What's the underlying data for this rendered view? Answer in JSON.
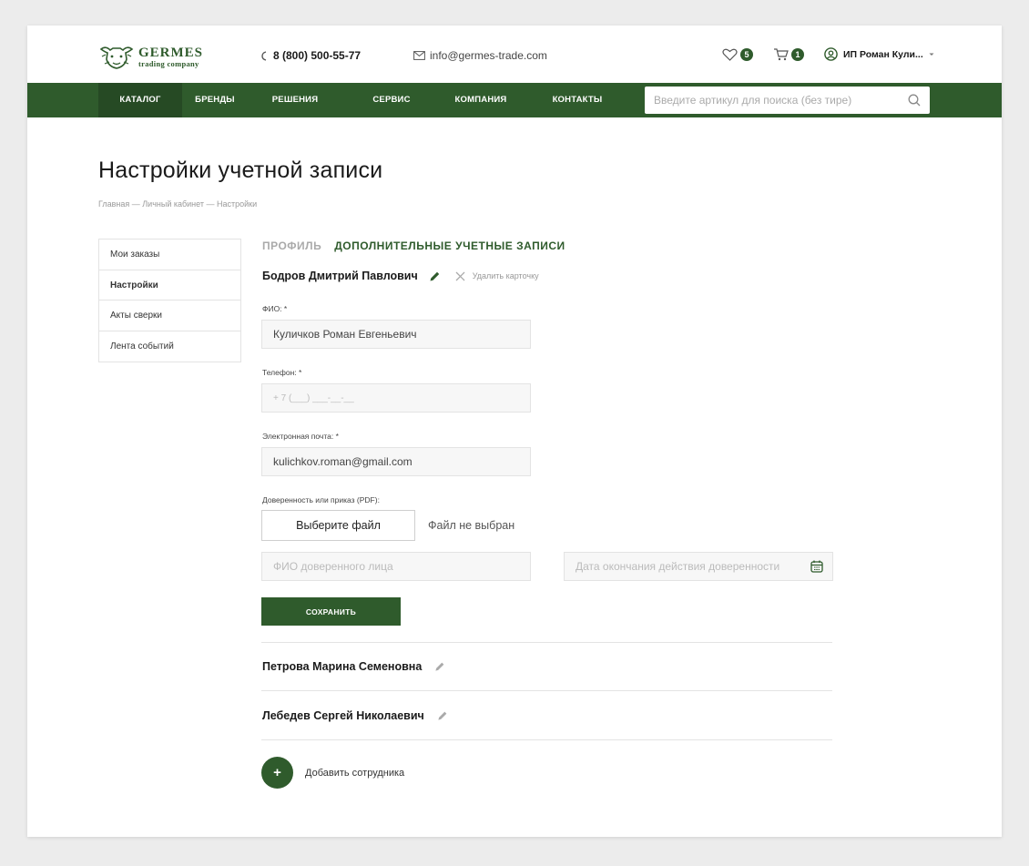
{
  "brand": {
    "title": "GERMES",
    "subtitle": "trading company"
  },
  "header": {
    "phone": "8 (800) 500-55-77",
    "email": "info@germes-trade.com",
    "favorites_count": "5",
    "cart_count": "1",
    "user_name": "ИП Роман Кули..."
  },
  "nav": {
    "items": [
      "КАТАЛОГ",
      "БРЕНДЫ",
      "РЕШЕНИЯ",
      "СЕРВИС",
      "КОМПАНИЯ",
      "КОНТАКТЫ"
    ],
    "search_placeholder": "Введите артикул для поиска (без тире)"
  },
  "page": {
    "title": "Настройки учетной записи",
    "breadcrumbs": "Главная — Личный кабинет — Настройки"
  },
  "sidebar": {
    "items": [
      "Мои заказы",
      "Настройки",
      "Акты сверки",
      "Лента событий"
    ]
  },
  "tabs": [
    "ПРОФИЛЬ",
    "ДОПОЛНИТЕЛЬНЫЕ УЧЕТНЫЕ ЗАПИСИ"
  ],
  "card": {
    "name": "Бодров Дмитрий Павлович",
    "delete_label": "Удалить карточку",
    "fio_label": "ФИО: *",
    "fio_value": "Куличков Роман Евгеньевич",
    "phone_label": "Телефон: *",
    "phone_placeholder": "+ 7 (___) ___-__-__",
    "email_label": "Электронная почта: *",
    "email_value": "kulichkov.roman@gmail.com",
    "doc_label": "Доверенность или приказ (PDF):",
    "file_button": "Выберите файл",
    "file_status": "Файл не выбран",
    "proxy_placeholder": "ФИО доверенного лица",
    "date_placeholder": "Дата окончания действия доверенности",
    "save_label": "СОХРАНИТЬ"
  },
  "employees": [
    "Петрова Марина Семеновна",
    "Лебедев Сергей Николаевич"
  ],
  "add_label": "Добавить сотрудника",
  "colors": {
    "brand_green": "#2f5b2c"
  }
}
